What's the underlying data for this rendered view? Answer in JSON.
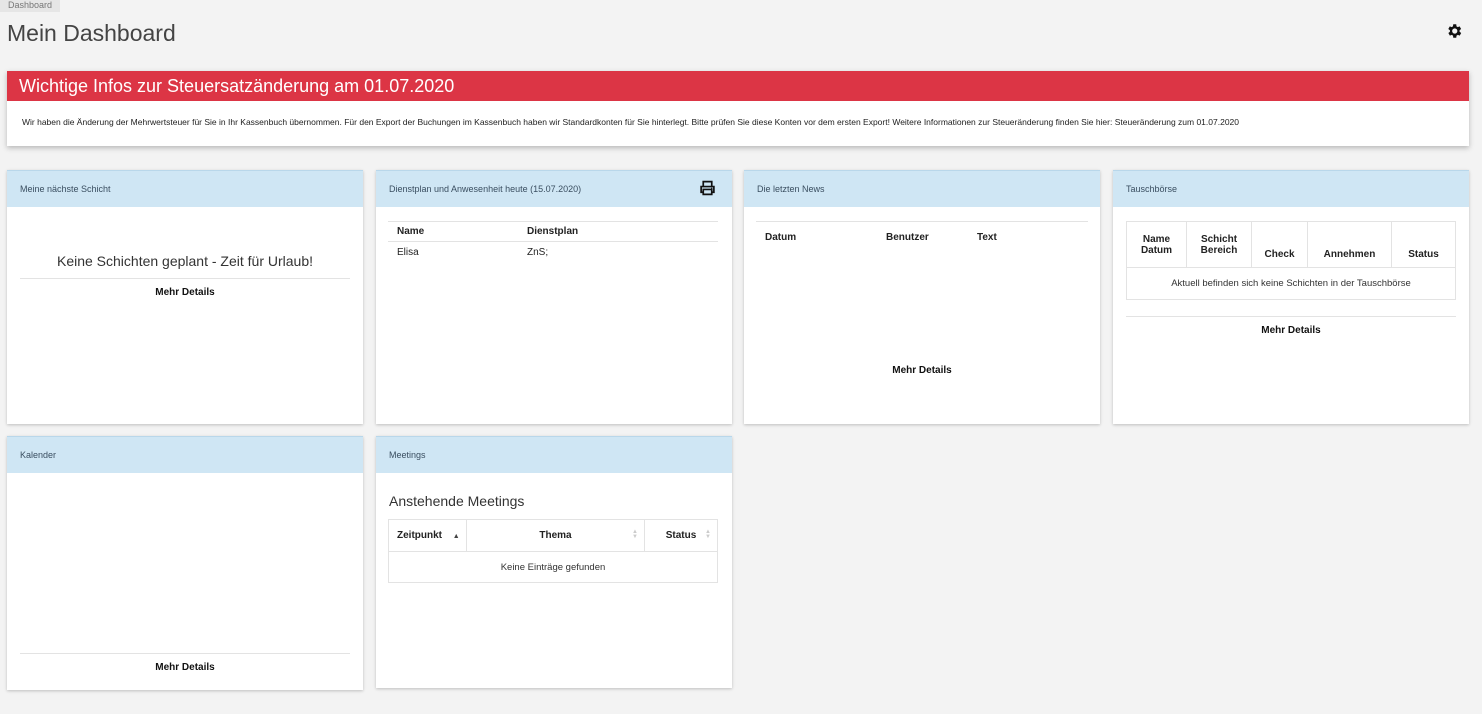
{
  "breadcrumb": "Dashboard",
  "page_title": "Mein Dashboard",
  "colors": {
    "alert": "#dc3545",
    "card_header": "#cfe6f4",
    "background": "#f3f3f3"
  },
  "info": {
    "title": "Wichtige Infos zur Steuersatzänderung am 01.07.2020",
    "text": "Wir haben die Änderung der Mehrwertsteuer für Sie in Ihr Kassenbuch übernommen. Für den Export der Buchungen im Kassenbuch haben wir Standardkonten für Sie hinterlegt. Bitte prüfen Sie diese Konten vor dem ersten Export! Weitere Informationen zur Steueränderung finden Sie hier: Steueränderung zum 01.07.2020"
  },
  "shift": {
    "title": "Meine nächste Schicht",
    "message": "Keine Schichten geplant - Zeit für Urlaub!",
    "details": "Mehr Details"
  },
  "roster": {
    "title": "Dienstplan und Anwesenheit heute (15.07.2020)",
    "headers": [
      "Name",
      "Dienstplan"
    ],
    "rows": [
      [
        "Elisa",
        "ZnS;"
      ]
    ],
    "icon": "print-icon"
  },
  "news": {
    "title": "Die letzten News",
    "headers": [
      "Datum",
      "Benutzer",
      "Text"
    ],
    "details": "Mehr Details"
  },
  "exchange": {
    "title": "Tauschbörse",
    "headers": [
      [
        "Name",
        "Datum"
      ],
      [
        "Schicht",
        "Bereich"
      ],
      [
        "Check"
      ],
      [
        "Annehmen"
      ],
      [
        "Status"
      ]
    ],
    "empty": "Aktuell befinden sich keine Schichten in der Tauschbörse",
    "details": "Mehr Details"
  },
  "calendar": {
    "title": "Kalender",
    "details": "Mehr Details"
  },
  "meetings": {
    "title": "Meetings",
    "subtitle": "Anstehende Meetings",
    "headers": [
      "Zeitpunkt",
      "Thema",
      "Status"
    ],
    "empty": "Keine Einträge gefunden"
  }
}
